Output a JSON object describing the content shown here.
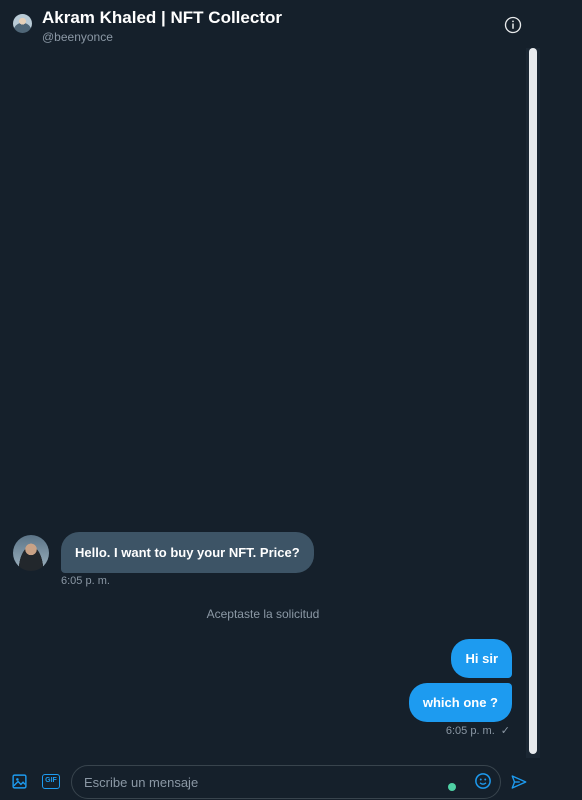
{
  "header": {
    "name": "Akram Khaled | NFT Collector",
    "handle": "@beenyonce",
    "icon": "info-icon"
  },
  "messages": [
    {
      "direction": "incoming",
      "text": "Hello. I want to buy your NFT. Price?",
      "time": "6:05 p. m."
    },
    {
      "direction": "system",
      "text": "Aceptaste la solicitud"
    },
    {
      "direction": "outgoing",
      "text": "Hi sir"
    },
    {
      "direction": "outgoing",
      "text": "which one ?",
      "time": "6:05 p. m.",
      "status": "✓"
    }
  ],
  "composer": {
    "placeholder": "Escribe un mensaje",
    "value": "",
    "gif_label": "GIF",
    "icons": [
      "media-icon",
      "gif-icon",
      "emoji-icon",
      "send-icon"
    ]
  },
  "colors": {
    "background": "#15202b",
    "accent": "#1d9bf0",
    "incoming_bubble": "#3d5466",
    "muted_text": "#8b98a5",
    "border": "#38444d"
  }
}
